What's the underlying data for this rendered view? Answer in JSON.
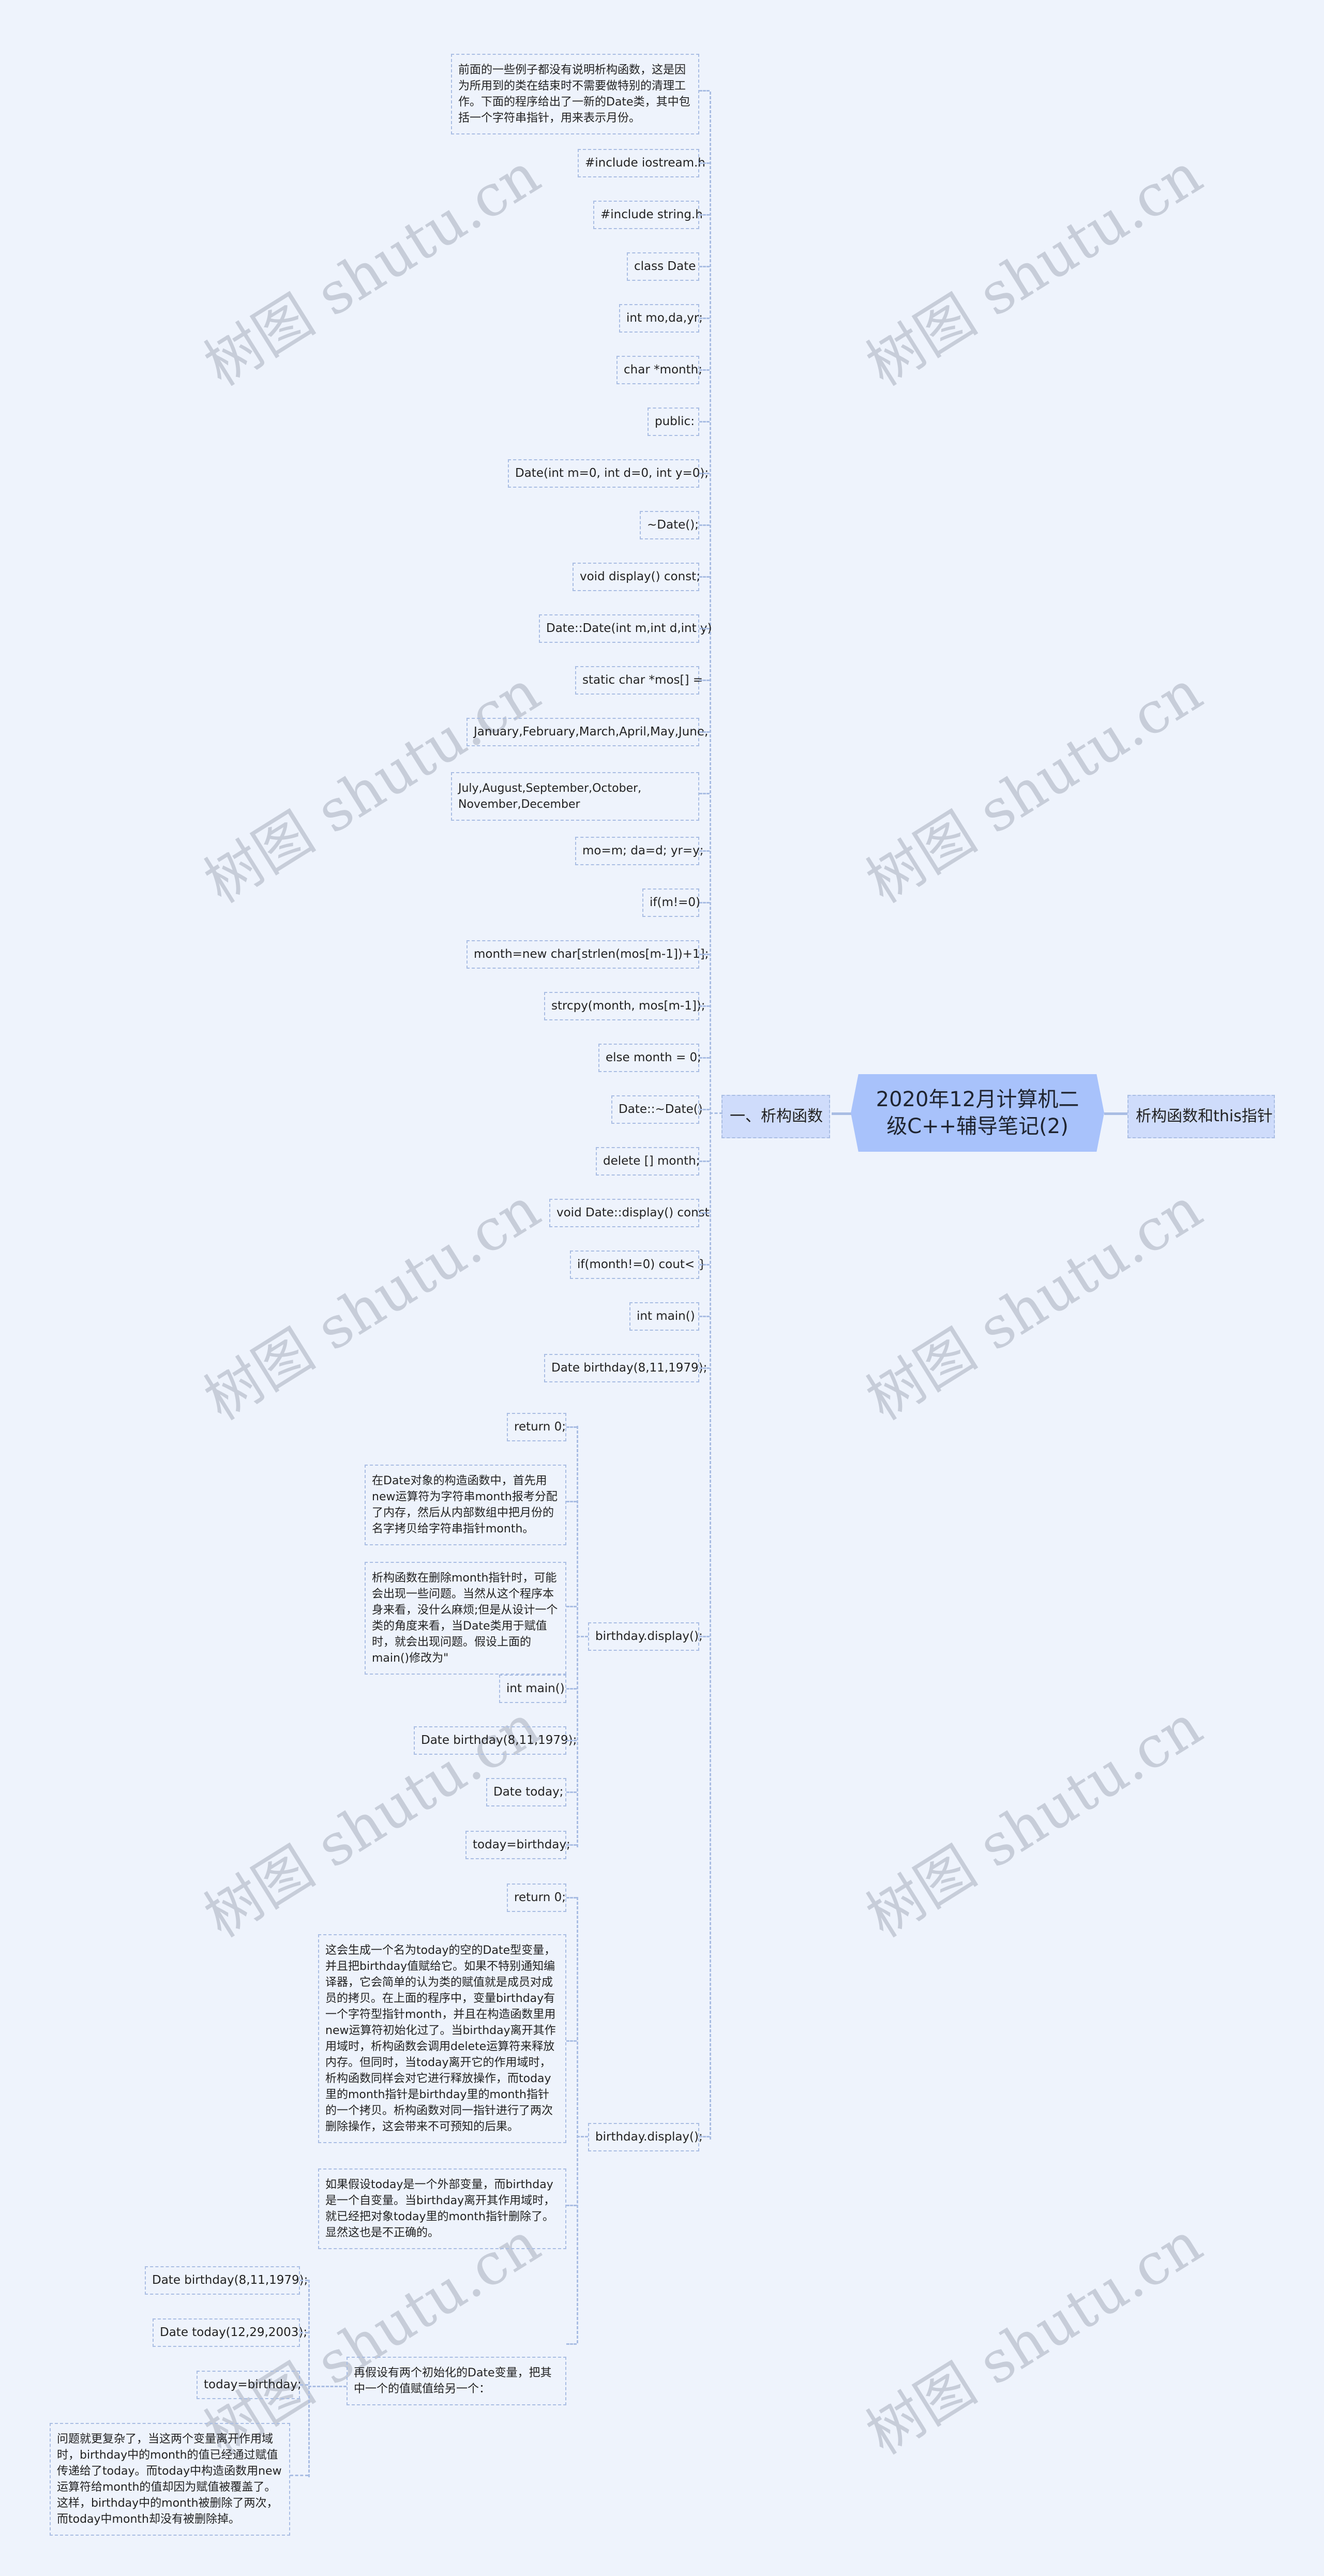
{
  "watermark": "树图 shutu.cn",
  "colors": {
    "background": "#eef3fc",
    "root": "#a8c2fb",
    "branch": "#cfdcfb",
    "connector": "#a9bde3"
  },
  "root": {
    "title": "2020年12月计算机二级C++辅导笔记(2)"
  },
  "right_branch": {
    "label": "析构函数和this指针"
  },
  "left_branch": {
    "label": "一、析构函数"
  },
  "top_nodes": [
    "前面的一些例子都没有说明析构函数，这是因为所用到的类在结束时不需要做特别的清理工作。下面的程序给出了一新的Date类，其中包括一个字符串指针，用来表示月份。",
    "#include iostream.h",
    "#include string.h",
    "class Date",
    "int mo,da,yr;",
    "char *month;",
    "public:",
    "Date(int m=0, int d=0, int y=0);",
    "~Date();",
    "void display() const;",
    "Date::Date(int m,int d,int y)",
    "static char *mos[] =",
    "January,February,March,April,May,June,",
    "July,August,September,October, November,December",
    "mo=m; da=d; yr=y;",
    "if(m!=0)",
    "month=new char[strlen(mos[m-1])+1];",
    "strcpy(month, mos[m-1]);",
    "else month = 0;",
    "Date::~Date()",
    "delete [] month;",
    "void Date::display() const",
    "if(month!=0) cout< }",
    "int main()",
    "Date birthday(8,11,1979);"
  ],
  "display1": {
    "label": "birthday.display();",
    "children": [
      "return 0;",
      "在Date对象的构造函数中，首先用new运算符为字符串month报考分配了内存，然后从内部数组中把月份的名字拷贝给字符串指针month。",
      "析构函数在删除month指针时，可能会出现一些问题。当然从这个程序本身来看，没什么麻烦;但是从设计一个类的角度来看，当Date类用于赋值时，就会出现问题。假设上面的main()修改为\"",
      "int main()",
      "Date birthday(8,11,1979);",
      "Date today;",
      "today=birthday;"
    ]
  },
  "display2": {
    "label": "birthday.display();",
    "children": [
      "return 0;",
      "这会生成一个名为today的空的Date型变量，并且把birthday值赋给它。如果不特别通知编译器，它会简单的认为类的赋值就是成员对成员的拷贝。在上面的程序中，变量birthday有一个字符型指针month，并且在构造函数里用new运算符初始化过了。当birthday离开其作用域时，析构函数会调用delete运算符来释放内存。但同时，当today离开它的作用域时，析构函数同样会对它进行释放操作，而today里的month指针是birthday里的month指针的一个拷贝。析构函数对同一指针进行了两次删除操作，这会带来不可预知的后果。",
      "如果假设today是一个外部变量，而birthday是一个自变量。当birthday离开其作用域时，就已经把对象today里的month指针删除了。显然这也是不正确的。"
    ],
    "sub": {
      "label": "再假设有两个初始化的Date变量，把其中一个的值赋值给另一个：",
      "children": [
        "Date birthday(8,11,1979);",
        "Date today(12,29,2003);",
        "today=birthday;",
        "问题就更复杂了，当这两个变量离开作用域时，birthday中的month的值已经通过赋值传递给了today。而today中构造函数用new运算符给month的值却因为赋值被覆盖了。这样，birthday中的month被删除了两次，而today中month却没有被删除掉。"
      ]
    }
  }
}
